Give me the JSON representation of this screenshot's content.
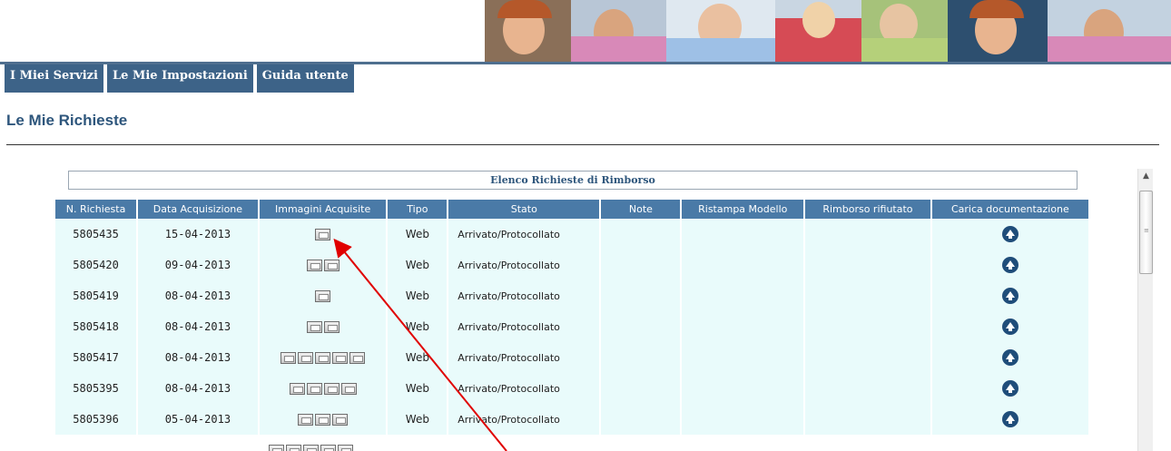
{
  "nav": {
    "tabs": [
      "I Miei Servizi",
      "Le Mie Impostazioni",
      "Guida utente"
    ]
  },
  "page": {
    "title": "Le Mie Richieste"
  },
  "table": {
    "caption": "Elenco Richieste di Rimborso",
    "headers": [
      "N. Richiesta",
      "Data Acquisizione",
      "Immagini Acquisite",
      "Tipo",
      "Stato",
      "Note",
      "Ristampa Modello",
      "Rimborso rifiutato",
      "Carica documentazione"
    ],
    "rows": [
      {
        "numero": "5805435",
        "data": "15-04-2013",
        "immagini": 1,
        "tipo": "Web",
        "stato": "Arrivato/Protocollato"
      },
      {
        "numero": "5805420",
        "data": "09-04-2013",
        "immagini": 2,
        "tipo": "Web",
        "stato": "Arrivato/Protocollato"
      },
      {
        "numero": "5805419",
        "data": "08-04-2013",
        "immagini": 1,
        "tipo": "Web",
        "stato": "Arrivato/Protocollato"
      },
      {
        "numero": "5805418",
        "data": "08-04-2013",
        "immagini": 2,
        "tipo": "Web",
        "stato": "Arrivato/Protocollato"
      },
      {
        "numero": "5805417",
        "data": "08-04-2013",
        "immagini": 5,
        "tipo": "Web",
        "stato": "Arrivato/Protocollato"
      },
      {
        "numero": "5805395",
        "data": "08-04-2013",
        "immagini": 4,
        "tipo": "Web",
        "stato": "Arrivato/Protocollato"
      },
      {
        "numero": "5805396",
        "data": "05-04-2013",
        "immagini": 3,
        "tipo": "Web",
        "stato": "Arrivato/Protocollato"
      }
    ],
    "partial_row_images": 5
  },
  "icons": {
    "image": "scanned-image-icon",
    "upload": "upload-arrow-icon"
  },
  "colors": {
    "nav_bg": "#3d6388",
    "header_bg": "#4a7aa7",
    "row_bg": "#e9fbfb",
    "title": "#2e567c",
    "annotation_arrow": "#e00000"
  }
}
